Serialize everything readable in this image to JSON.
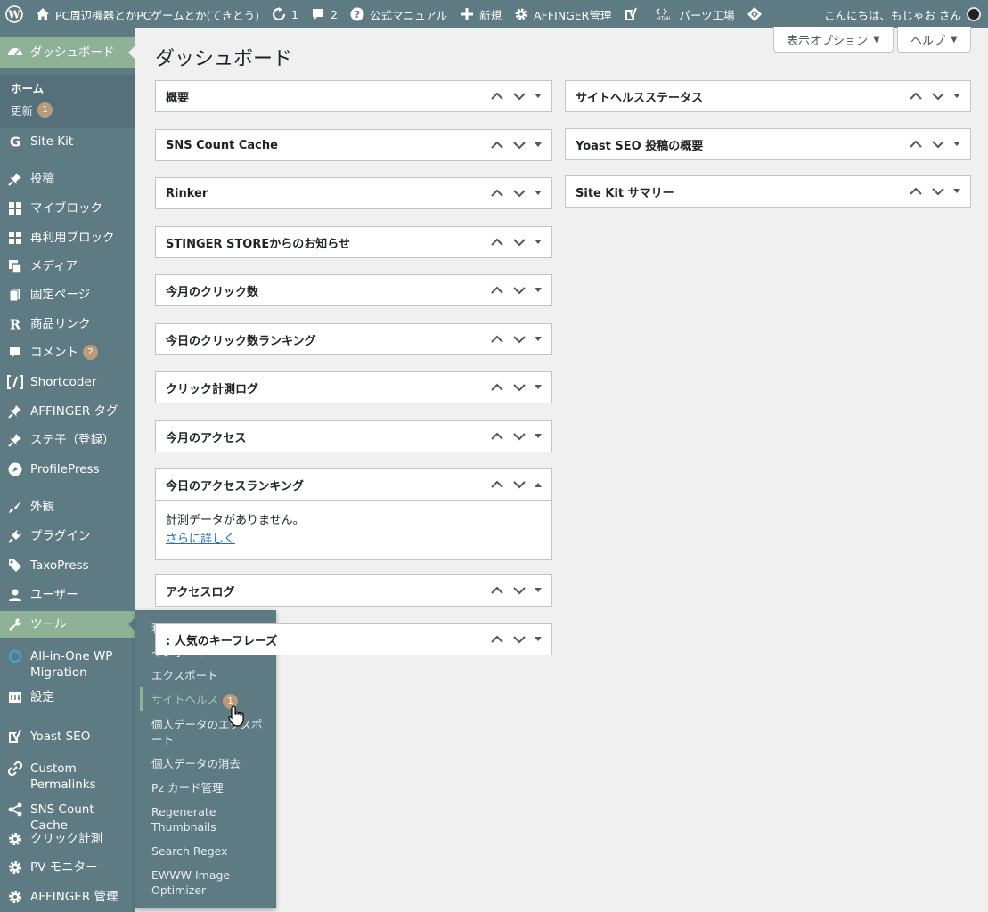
{
  "adminbar": {
    "site_name": "PC周辺機器とかPCゲームとか(てきとう)",
    "updates_count": "1",
    "comments_count": "2",
    "manual": "公式マニュアル",
    "new": "新規",
    "affinger": "AFFINGER管理",
    "parts": "パーツ工場",
    "greeting": "こんにちは、もじゃお さん"
  },
  "sidebar": {
    "dashboard": "ダッシュボード",
    "home": "ホーム",
    "updates": "更新",
    "updates_badge": "1",
    "items": [
      {
        "label": "Site Kit",
        "icon": "google-g-icon"
      },
      {
        "label": "投稿",
        "icon": "pin-icon"
      },
      {
        "label": "マイブロック",
        "icon": "blocks-icon"
      },
      {
        "label": "再利用ブロック",
        "icon": "blocks-icon"
      },
      {
        "label": "メディア",
        "icon": "media-icon"
      },
      {
        "label": "固定ページ",
        "icon": "page-icon"
      },
      {
        "label": "商品リンク",
        "icon": "r-icon"
      },
      {
        "label": "コメント",
        "icon": "comment-icon",
        "badge": "2"
      },
      {
        "label": "Shortcoder",
        "icon": "shortcode-icon"
      },
      {
        "label": "AFFINGER タグ",
        "icon": "pin-icon"
      },
      {
        "label": "ステ子（登録）",
        "icon": "pin-icon"
      },
      {
        "label": "ProfilePress",
        "icon": "profilepress-icon"
      },
      {
        "label": "外観",
        "icon": "brush-icon"
      },
      {
        "label": "プラグイン",
        "icon": "plugin-icon"
      },
      {
        "label": "TaxoPress",
        "icon": "tag-icon"
      },
      {
        "label": "ユーザー",
        "icon": "user-icon"
      },
      {
        "label": "ツール",
        "icon": "wrench-icon"
      },
      {
        "label": "All-in-One WP Migration",
        "icon": "migration-icon"
      },
      {
        "label": "設定",
        "icon": "settings-icon"
      },
      {
        "label": "Yoast SEO",
        "icon": "yoast-icon"
      },
      {
        "label": "Custom Permalinks",
        "icon": "link-icon"
      },
      {
        "label": "SNS Count Cache",
        "icon": "share-icon"
      },
      {
        "label": "クリック計測",
        "icon": "gear-icon"
      },
      {
        "label": "PV モニター",
        "icon": "gear-icon"
      },
      {
        "label": "AFFINGER 管理",
        "icon": "gear-icon"
      }
    ]
  },
  "flyout": {
    "items": [
      "利用可能なツール",
      "インポート",
      "エクスポート",
      "サイトヘルス",
      "個人データのエクスポート",
      "個人データの消去",
      "Pz カード管理",
      "Regenerate Thumbnails",
      "Search Regex",
      "EWWW Image Optimizer"
    ],
    "site_health_badge": "1"
  },
  "main": {
    "title": "ダッシュボード",
    "screen_options": "表示オプション",
    "help": "ヘルプ",
    "left_boxes": [
      "概要",
      "SNS Count Cache",
      "Rinker",
      "STINGER STOREからのお知らせ",
      "今月のクリック数",
      "今日のクリック数ランキング",
      "クリック計測ログ",
      "今月のアクセス",
      "今日のアクセスランキング",
      "アクセスログ",
      ": 人気のキーフレーズ"
    ],
    "open_box_text": "計測データがありません。",
    "open_box_link": "さらに詳しく",
    "right_boxes": [
      "サイトヘルスステータス",
      "Yoast SEO 投稿の概要",
      "Site Kit サマリー"
    ]
  }
}
